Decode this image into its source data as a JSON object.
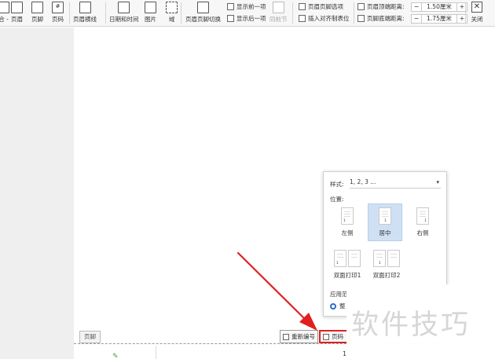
{
  "ribbon": {
    "cut_label": "合 -",
    "page_header": "页眉",
    "page_footer": "页脚",
    "page_number": "页码",
    "header_line": "页眉横线",
    "date_time": "日期和时间",
    "picture": "图片",
    "field": "域",
    "switch_header_footer": "页眉页脚切换",
    "show_prev": "显示前一项",
    "show_next": "显示后一项",
    "same_as_prev": "同前节",
    "header_footer_options": "页眉页脚选项",
    "insert_alignment_tab": "插入对齐制表位",
    "header_top_distance_label": "页眉顶端距离:",
    "header_top_distance_value": "1.50厘米",
    "footer_bottom_distance_label": "页脚底端距离:",
    "footer_bottom_distance_value": "1.75厘米",
    "minus": "−",
    "plus": "+",
    "close": "关闭"
  },
  "document": {
    "footer_label": "页脚",
    "renumber_button": "重新编号",
    "page_number_button": "页码",
    "page_number_text": "1"
  },
  "popup": {
    "style_label": "样式:",
    "style_value": "1, 2, 3 ...",
    "position_label": "位置:",
    "positions": [
      {
        "label": "左侧",
        "num": "1",
        "selected": false
      },
      {
        "label": "居中",
        "num": "1",
        "selected": true
      },
      {
        "label": "右侧",
        "num": "1",
        "selected": false
      },
      {
        "label": "双面打印1",
        "num": "1",
        "selected": false
      },
      {
        "label": "双面打印2",
        "num": "1",
        "selected": false
      }
    ],
    "apply_label": "应用范",
    "radio_label": "整"
  },
  "watermark": "软件技巧",
  "colors": {
    "highlight": "#e02020",
    "selected_bg": "#cfe0f5",
    "arrow": "#e02020",
    "radio": "#2c6ec8"
  },
  "icons": {
    "close": "close-icon",
    "doc": "document-icon"
  }
}
